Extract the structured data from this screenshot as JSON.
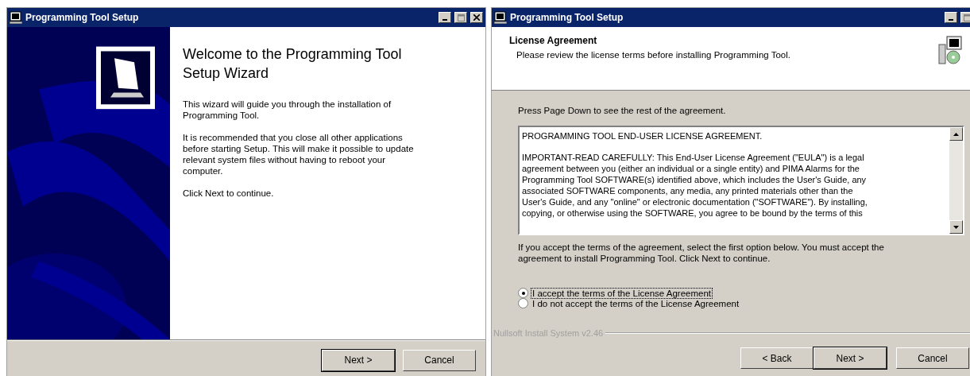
{
  "windows": [
    {
      "kind": "welcome",
      "title": "Programming Tool Setup",
      "heading": "Welcome to the Programming Tool\nSetup Wizard",
      "paragraphs": [
        "This wizard will guide you through the installation of\nProgramming Tool.",
        "It is recommended that you close all other applications\nbefore starting Setup. This will make it possible to update\nrelevant system files without having to reboot your\ncomputer.",
        "Click Next to continue."
      ],
      "buttons": [
        {
          "label": "Next >",
          "default": true
        },
        {
          "label": "Cancel",
          "default": false
        }
      ]
    },
    {
      "kind": "license",
      "title": "Programming Tool Setup",
      "heading": "License Agreement",
      "subheading": "Please review the license terms before installing Programming Tool.",
      "instruction": "Press Page Down to see the rest of the agreement.",
      "license_text": [
        "PROGRAMMING TOOL END-USER LICENSE AGREEMENT.",
        "IMPORTANT-READ CAREFULLY: This End-User License Agreement (\"EULA\") is a legal\nagreement between you (either an individual or a single entity) and PIMA Alarms for the\nProgramming Tool SOFTWARE(s) identified above, which includes the User's Guide, any\nassociated SOFTWARE components, any media, any printed materials other than the\nUser's Guide, and any \"online\" or electronic documentation (\"SOFTWARE\"). By installing,\ncopying, or otherwise using the SOFTWARE, you agree to be bound by the terms of this"
      ],
      "note": "If you accept the terms of the agreement, select the first option below. You must accept the\nagreement to install Programming Tool. Click Next to continue.",
      "options": [
        {
          "label": "I accept the terms of the License Agreement",
          "selected": true
        },
        {
          "label": "I do not accept the terms of the License Agreement",
          "selected": false
        }
      ],
      "branding": "Nullsoft Install System v2.46",
      "buttons": [
        {
          "label": "< Back",
          "default": false
        },
        {
          "label": "Next >",
          "default": true
        },
        {
          "label": "Cancel",
          "default": false
        }
      ]
    }
  ]
}
